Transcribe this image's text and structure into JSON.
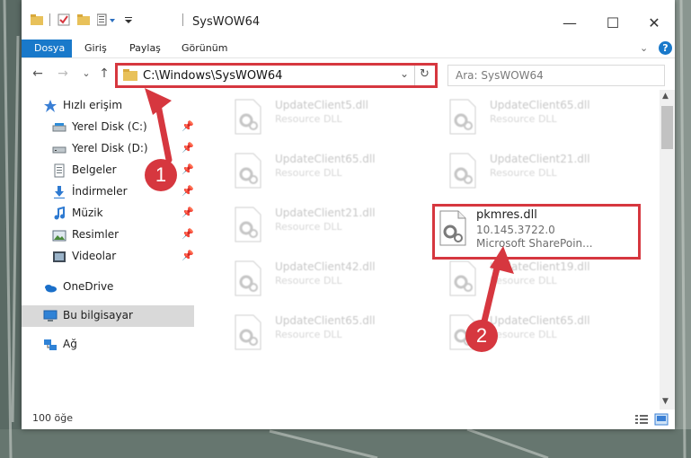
{
  "window": {
    "title": "SysWOW64",
    "controls": {
      "minimize": "—",
      "maximize": "☐",
      "close": "✕"
    }
  },
  "ribbon": {
    "tabs": [
      {
        "label": "Dosya",
        "active": true
      },
      {
        "label": "Giriş"
      },
      {
        "label": "Paylaş"
      },
      {
        "label": "Görünüm"
      }
    ],
    "help": "?",
    "expand": "⌄"
  },
  "address": {
    "path": "C:\\Windows\\SysWOW64",
    "back": "←",
    "forward": "→",
    "recent": "⌄",
    "up": "↑",
    "dropdown": "⌄",
    "refresh": "↻"
  },
  "search": {
    "placeholder": "Ara: SysWOW64"
  },
  "nav": {
    "items": [
      {
        "label": "Hızlı erişim",
        "icon": "star-icon"
      },
      {
        "label": "Yerel Disk (C:)",
        "icon": "drive-icon",
        "pinned": true
      },
      {
        "label": "Yerel Disk (D:)",
        "icon": "drive-icon",
        "pinned": true
      },
      {
        "label": "Belgeler",
        "icon": "documents-icon",
        "pinned": true
      },
      {
        "label": "İndirmeler",
        "icon": "downloads-icon",
        "pinned": true
      },
      {
        "label": "Müzik",
        "icon": "music-icon",
        "pinned": true
      },
      {
        "label": "Resimler",
        "icon": "pictures-icon",
        "pinned": true
      },
      {
        "label": "Videolar",
        "icon": "videos-icon",
        "pinned": true
      },
      {
        "label": "OneDrive",
        "icon": "cloud-icon"
      },
      {
        "label": "Bu bilgisayar",
        "icon": "computer-icon",
        "selected": true
      },
      {
        "label": "Ağ",
        "icon": "network-icon"
      }
    ]
  },
  "files": [
    {
      "name": "UpdateClient5.dll",
      "desc": "Resource DLL"
    },
    {
      "name": "UpdateClient65.dll",
      "desc": "Resource DLL"
    },
    {
      "name": "UpdateClient65.dll",
      "desc": "Resource DLL"
    },
    {
      "name": "UpdateClient21.dll",
      "desc": "Resource DLL"
    },
    {
      "name": "UpdateClient21.dll",
      "desc": "Resource DLL"
    },
    {
      "name": "pkmres.dll",
      "version": "10.145.3722.0",
      "desc": "Microsoft SharePoin...",
      "highlighted": true
    },
    {
      "name": "UpdateClient42.dll",
      "desc": "Resource DLL"
    },
    {
      "name": "UpdateClient19.dll",
      "desc": "Resource DLL"
    },
    {
      "name": "UpdateClient65.dll",
      "desc": "Resource DLL"
    },
    {
      "name": "UpdateClient65.dll",
      "desc": "Resource DLL"
    }
  ],
  "status": {
    "count": "100 öğe"
  },
  "callouts": [
    "1",
    "2"
  ],
  "colors": {
    "accent": "#1979ca",
    "highlight": "#d6373f",
    "selected": "#d9d9d9"
  }
}
